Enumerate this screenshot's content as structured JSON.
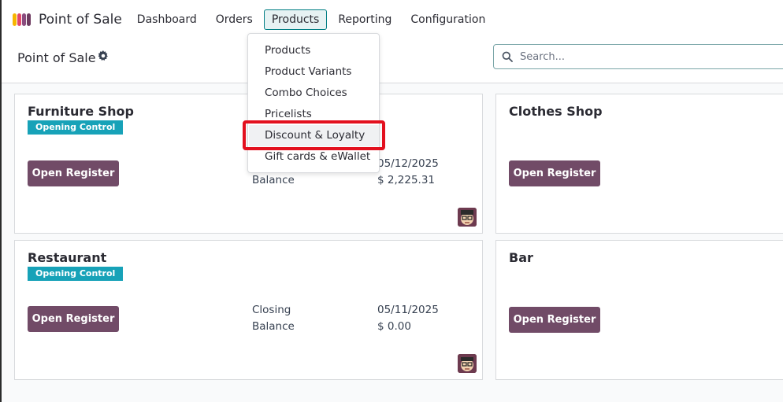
{
  "app": {
    "name": "Point of Sale"
  },
  "nav": {
    "items": [
      {
        "label": "Dashboard"
      },
      {
        "label": "Orders"
      },
      {
        "label": "Products"
      },
      {
        "label": "Reporting"
      },
      {
        "label": "Configuration"
      }
    ],
    "active": "Products"
  },
  "control": {
    "title": "Point of Sale",
    "search_placeholder": "Search..."
  },
  "products_menu": {
    "items": [
      {
        "label": "Products"
      },
      {
        "label": "Product Variants"
      },
      {
        "label": "Combo Choices"
      },
      {
        "label": "Pricelists"
      },
      {
        "label": "Discount & Loyalty"
      },
      {
        "label": "Gift cards & eWallet"
      }
    ],
    "highlighted": "Discount & Loyalty"
  },
  "shops": [
    {
      "name": "Furniture Shop",
      "badge": "Opening Control",
      "button": "Open Register",
      "info_label": "Balance",
      "date": "05/12/2025",
      "balance": "$ 2,225.31"
    },
    {
      "name": "Clothes Shop",
      "button": "Open Register"
    },
    {
      "name": "Restaurant",
      "badge": "Opening Control",
      "button": "Open Register",
      "closing_label": "Closing",
      "info_label": "Balance",
      "date": "05/11/2025",
      "balance": "$ 0.00"
    },
    {
      "name": "Bar",
      "button": "Open Register"
    }
  ],
  "colors": {
    "brand_primary": "#714b67",
    "accent_teal": "#017e84",
    "badge": "#17a2b8",
    "highlight": "#e3101e"
  },
  "icons": [
    "pos-logo-icon",
    "gear-icon",
    "search-icon",
    "user-avatar-icon"
  ]
}
